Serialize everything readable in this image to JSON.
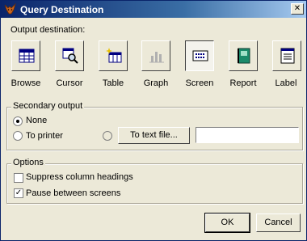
{
  "title": "Query Destination",
  "output_destination_label": "Output destination:",
  "destinations": [
    {
      "label": "Browse",
      "icon": "browse-grid-icon"
    },
    {
      "label": "Cursor",
      "icon": "cursor-magnifier-icon"
    },
    {
      "label": "Table",
      "icon": "table-sparkle-icon"
    },
    {
      "label": "Graph",
      "icon": "graph-bars-icon"
    },
    {
      "label": "Screen",
      "icon": "screen-text-icon"
    },
    {
      "label": "Report",
      "icon": "report-book-icon"
    },
    {
      "label": "Label",
      "icon": "label-list-icon"
    }
  ],
  "selected_destination": "Screen",
  "secondary": {
    "legend": "Secondary output",
    "none_label": "None",
    "printer_label": "To printer",
    "textfile_button": "To text file...",
    "textfile_value": ""
  },
  "options": {
    "legend": "Options",
    "suppress_label": "Suppress column headings",
    "suppress_checked": false,
    "pause_label": "Pause between screens",
    "pause_checked": true
  },
  "ok_label": "OK",
  "cancel_label": "Cancel"
}
